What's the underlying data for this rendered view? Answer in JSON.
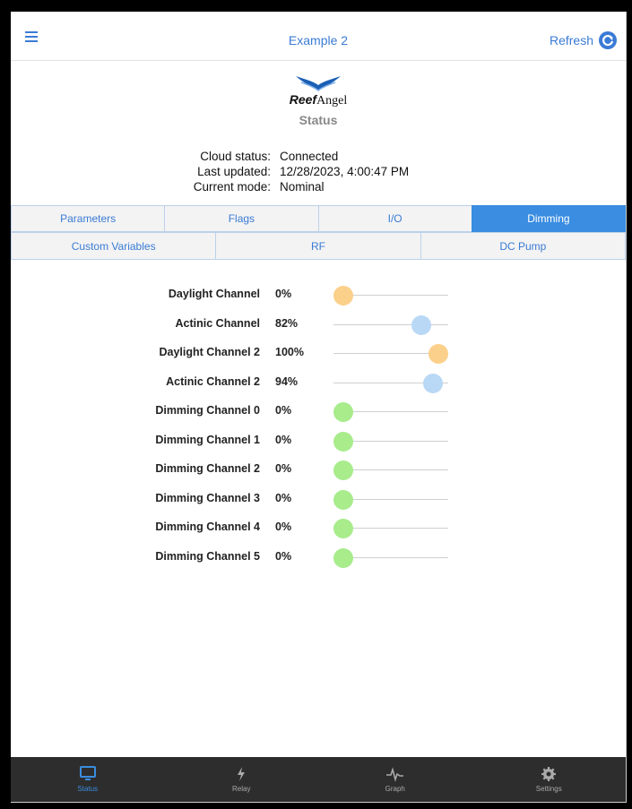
{
  "header": {
    "title": "Example 2",
    "refresh_label": "Refresh"
  },
  "logo": {
    "brand_bold": "Reef",
    "brand_rest": "Angel"
  },
  "page_title": "Status",
  "info": [
    {
      "label": "Cloud status:",
      "value": "Connected"
    },
    {
      "label": "Last updated:",
      "value": "12/28/2023, 4:00:47 PM"
    },
    {
      "label": "Current mode:",
      "value": "Nominal"
    }
  ],
  "tabs_row1": [
    "Parameters",
    "Flags",
    "I/O",
    "Dimming"
  ],
  "tabs_row2": [
    "Custom Variables",
    "RF",
    "DC Pump"
  ],
  "active_tab": "Dimming",
  "colors": {
    "accent": "#3a8de0",
    "daylight": "#fbd08a",
    "actinic": "#b9d8f6",
    "dimming": "#a8ec8c"
  },
  "channels": [
    {
      "name": "Daylight Channel",
      "value": "0%",
      "level": 0,
      "kind": "daylight"
    },
    {
      "name": "Actinic Channel",
      "value": "82%",
      "level": 0.82,
      "kind": "actinic"
    },
    {
      "name": "Daylight Channel 2",
      "value": "100%",
      "level": 1.0,
      "kind": "daylight"
    },
    {
      "name": "Actinic Channel 2",
      "value": "94%",
      "level": 0.94,
      "kind": "actinic"
    },
    {
      "name": "Dimming Channel 0",
      "value": "0%",
      "level": 0,
      "kind": "dimming"
    },
    {
      "name": "Dimming Channel 1",
      "value": "0%",
      "level": 0,
      "kind": "dimming"
    },
    {
      "name": "Dimming Channel 2",
      "value": "0%",
      "level": 0,
      "kind": "dimming"
    },
    {
      "name": "Dimming Channel 3",
      "value": "0%",
      "level": 0,
      "kind": "dimming"
    },
    {
      "name": "Dimming Channel 4",
      "value": "0%",
      "level": 0,
      "kind": "dimming"
    },
    {
      "name": "Dimming Channel 5",
      "value": "0%",
      "level": 0,
      "kind": "dimming"
    }
  ],
  "bottom_nav": [
    {
      "label": "Status",
      "icon": "monitor-icon"
    },
    {
      "label": "Relay",
      "icon": "lightning-icon"
    },
    {
      "label": "Graph",
      "icon": "pulse-icon"
    },
    {
      "label": "Settings",
      "icon": "gear-icon"
    }
  ],
  "active_nav": "Status"
}
